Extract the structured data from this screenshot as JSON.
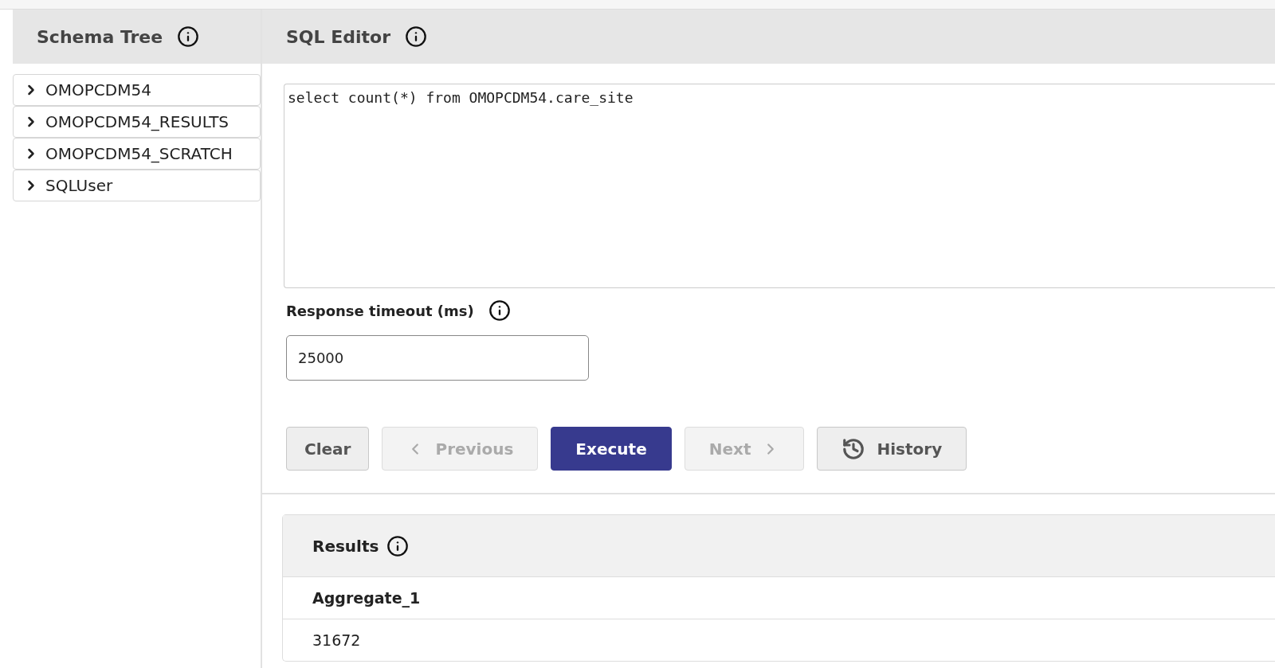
{
  "schema_tree": {
    "title": "Schema Tree",
    "items": [
      {
        "label": "OMOPCDM54",
        "expanded": false
      },
      {
        "label": "OMOPCDM54_RESULTS",
        "expanded": false
      },
      {
        "label": "OMOPCDM54_SCRATCH",
        "expanded": false
      },
      {
        "label": "SQLUser",
        "expanded": false
      }
    ]
  },
  "sql_editor": {
    "title": "SQL Editor",
    "query": "select count(*) from OMOPCDM54.care_site",
    "timeout_label": "Response timeout (ms)",
    "timeout_value": "25000",
    "buttons": [
      {
        "label": "Clear",
        "kind": "plain",
        "disabled": false
      },
      {
        "label": "Previous",
        "kind": "prev",
        "disabled": true
      },
      {
        "label": "Execute",
        "kind": "primary",
        "disabled": false
      },
      {
        "label": "Next",
        "kind": "next",
        "disabled": true
      },
      {
        "label": "History",
        "kind": "history",
        "disabled": false
      }
    ]
  },
  "results": {
    "title": "Results",
    "columns": [
      "Aggregate_1"
    ],
    "rows": [
      [
        "31672"
      ]
    ]
  }
}
